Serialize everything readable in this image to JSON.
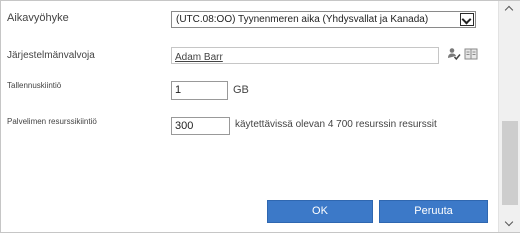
{
  "timezone": {
    "label": "Aikavyöhyke",
    "value": "(UTC.08:OO) Tyynenmeren aika (Yhdysvallat ja Kanada)"
  },
  "site_admin": {
    "label": "Järjestelmänvalvoja",
    "value": "Adam Barr",
    "icons": [
      "check-names-icon",
      "address-book-icon"
    ]
  },
  "storage_quota": {
    "label": "Tallennuskiintiö",
    "value": "1",
    "unit": "GB"
  },
  "resource_quota": {
    "label": "Palvelimen resurssikiintiö",
    "value": "300",
    "note": "käytettävissä olevan 4 700 resurssin resurssit"
  },
  "buttons": {
    "ok": "OK",
    "cancel": "Peruuta"
  },
  "colors": {
    "button_bg": "#3c79c8",
    "button_text": "#ffffff",
    "label_text": "#444444"
  }
}
